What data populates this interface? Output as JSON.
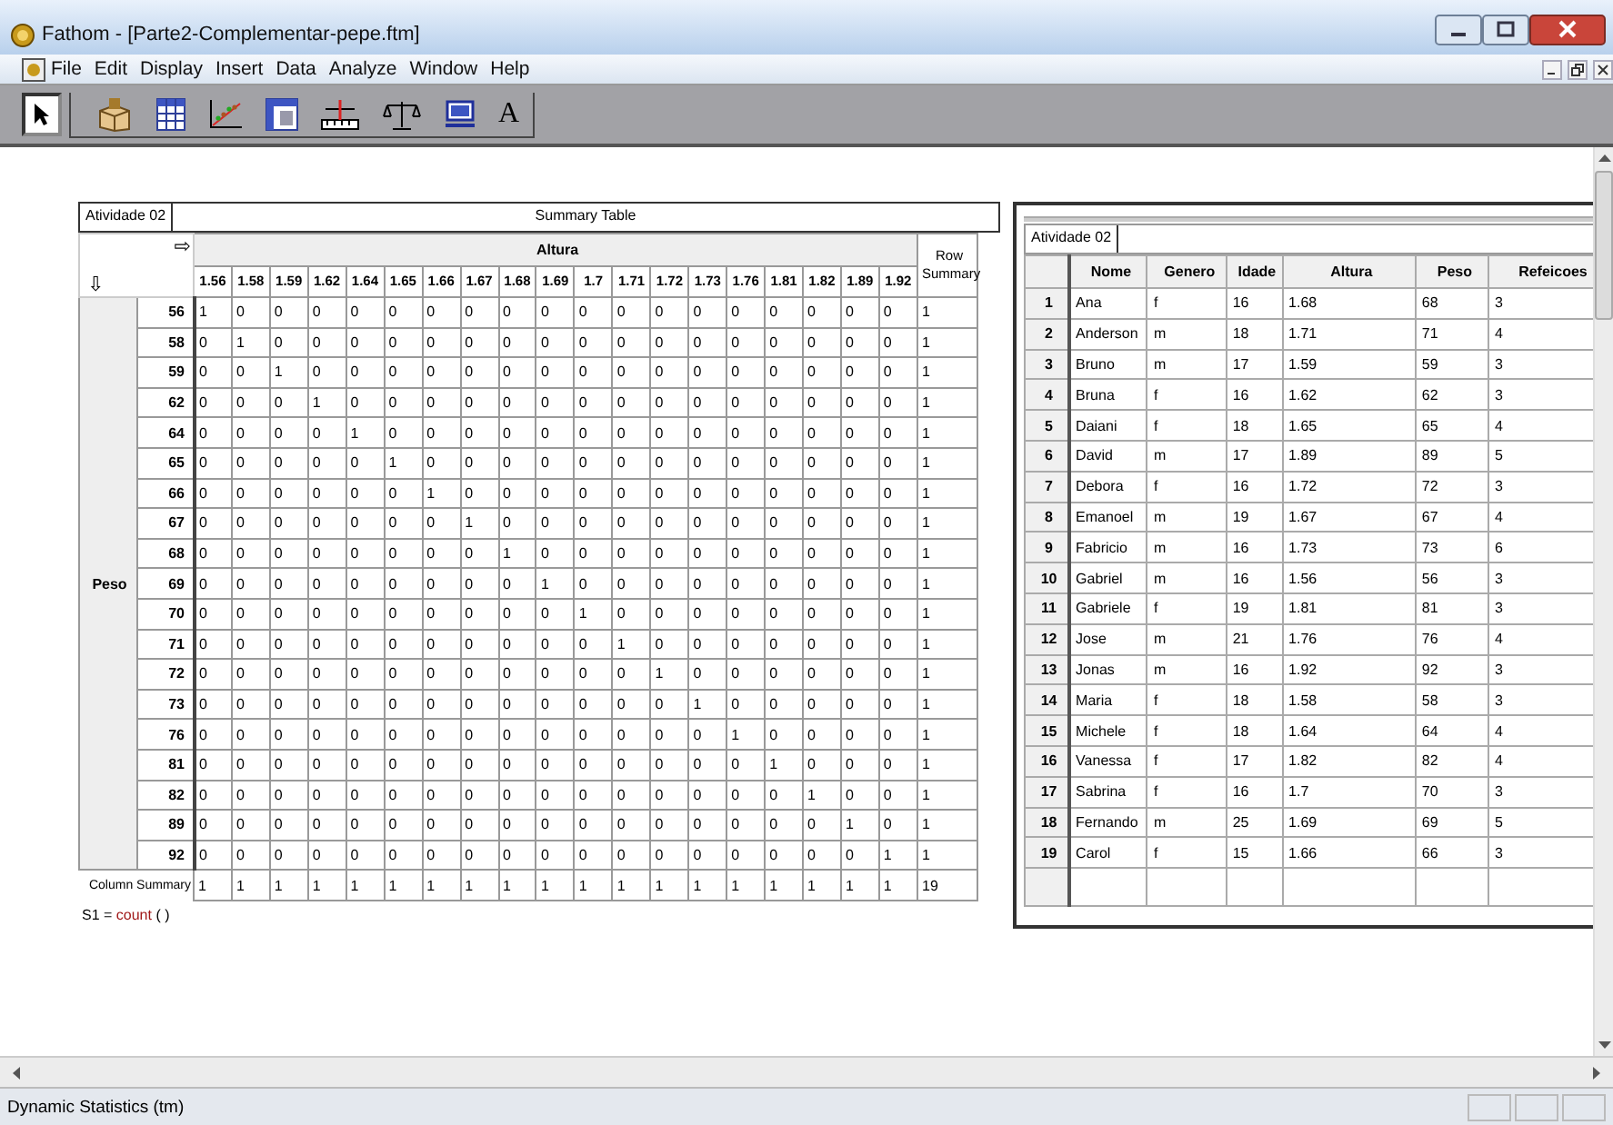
{
  "window": {
    "title": "Fathom - [Parte2-Complementar-pepe.ftm]"
  },
  "menu": [
    "File",
    "Edit",
    "Display",
    "Insert",
    "Data",
    "Analyze",
    "Window",
    "Help"
  ],
  "toolbar": [
    {
      "kind": "pointer",
      "selected": true
    },
    {
      "kind": "box",
      "selected": false
    },
    {
      "kind": "table",
      "selected": false
    },
    {
      "kind": "graph",
      "selected": false
    },
    {
      "kind": "summary",
      "selected": false
    },
    {
      "kind": "ruler",
      "selected": false
    },
    {
      "kind": "scale",
      "selected": false
    },
    {
      "kind": "monitor",
      "selected": false
    },
    {
      "kind": "text",
      "label": "A",
      "selected": false
    }
  ],
  "summary_table": {
    "collection": "Atividade 02",
    "title": "Summary Table",
    "row_arrow": "⇩",
    "column_arrow": "⇨",
    "column_attribute": "Altura",
    "row_attribute": "Peso",
    "row_summary_label": "Row Summary",
    "columns": [
      "1.56",
      "1.58",
      "1.59",
      "1.62",
      "1.64",
      "1.65",
      "1.66",
      "1.67",
      "1.68",
      "1.69",
      "1.7",
      "1.71",
      "1.72",
      "1.73",
      "1.76",
      "1.81",
      "1.82",
      "1.89",
      "1.92"
    ],
    "rows": [
      {
        "label": "56",
        "cells": [
          "1",
          "0",
          "0",
          "0",
          "0",
          "0",
          "0",
          "0",
          "0",
          "0",
          "0",
          "0",
          "0",
          "0",
          "0",
          "0",
          "0",
          "0",
          "0"
        ],
        "summary": "1"
      },
      {
        "label": "58",
        "cells": [
          "0",
          "1",
          "0",
          "0",
          "0",
          "0",
          "0",
          "0",
          "0",
          "0",
          "0",
          "0",
          "0",
          "0",
          "0",
          "0",
          "0",
          "0",
          "0"
        ],
        "summary": "1"
      },
      {
        "label": "59",
        "cells": [
          "0",
          "0",
          "1",
          "0",
          "0",
          "0",
          "0",
          "0",
          "0",
          "0",
          "0",
          "0",
          "0",
          "0",
          "0",
          "0",
          "0",
          "0",
          "0"
        ],
        "summary": "1"
      },
      {
        "label": "62",
        "cells": [
          "0",
          "0",
          "0",
          "1",
          "0",
          "0",
          "0",
          "0",
          "0",
          "0",
          "0",
          "0",
          "0",
          "0",
          "0",
          "0",
          "0",
          "0",
          "0"
        ],
        "summary": "1"
      },
      {
        "label": "64",
        "cells": [
          "0",
          "0",
          "0",
          "0",
          "1",
          "0",
          "0",
          "0",
          "0",
          "0",
          "0",
          "0",
          "0",
          "0",
          "0",
          "0",
          "0",
          "0",
          "0"
        ],
        "summary": "1"
      },
      {
        "label": "65",
        "cells": [
          "0",
          "0",
          "0",
          "0",
          "0",
          "1",
          "0",
          "0",
          "0",
          "0",
          "0",
          "0",
          "0",
          "0",
          "0",
          "0",
          "0",
          "0",
          "0"
        ],
        "summary": "1"
      },
      {
        "label": "66",
        "cells": [
          "0",
          "0",
          "0",
          "0",
          "0",
          "0",
          "1",
          "0",
          "0",
          "0",
          "0",
          "0",
          "0",
          "0",
          "0",
          "0",
          "0",
          "0",
          "0"
        ],
        "summary": "1"
      },
      {
        "label": "67",
        "cells": [
          "0",
          "0",
          "0",
          "0",
          "0",
          "0",
          "0",
          "1",
          "0",
          "0",
          "0",
          "0",
          "0",
          "0",
          "0",
          "0",
          "0",
          "0",
          "0"
        ],
        "summary": "1"
      },
      {
        "label": "68",
        "cells": [
          "0",
          "0",
          "0",
          "0",
          "0",
          "0",
          "0",
          "0",
          "1",
          "0",
          "0",
          "0",
          "0",
          "0",
          "0",
          "0",
          "0",
          "0",
          "0"
        ],
        "summary": "1"
      },
      {
        "label": "69",
        "cells": [
          "0",
          "0",
          "0",
          "0",
          "0",
          "0",
          "0",
          "0",
          "0",
          "1",
          "0",
          "0",
          "0",
          "0",
          "0",
          "0",
          "0",
          "0",
          "0"
        ],
        "summary": "1"
      },
      {
        "label": "70",
        "cells": [
          "0",
          "0",
          "0",
          "0",
          "0",
          "0",
          "0",
          "0",
          "0",
          "0",
          "1",
          "0",
          "0",
          "0",
          "0",
          "0",
          "0",
          "0",
          "0"
        ],
        "summary": "1"
      },
      {
        "label": "71",
        "cells": [
          "0",
          "0",
          "0",
          "0",
          "0",
          "0",
          "0",
          "0",
          "0",
          "0",
          "0",
          "1",
          "0",
          "0",
          "0",
          "0",
          "0",
          "0",
          "0"
        ],
        "summary": "1"
      },
      {
        "label": "72",
        "cells": [
          "0",
          "0",
          "0",
          "0",
          "0",
          "0",
          "0",
          "0",
          "0",
          "0",
          "0",
          "0",
          "1",
          "0",
          "0",
          "0",
          "0",
          "0",
          "0"
        ],
        "summary": "1"
      },
      {
        "label": "73",
        "cells": [
          "0",
          "0",
          "0",
          "0",
          "0",
          "0",
          "0",
          "0",
          "0",
          "0",
          "0",
          "0",
          "0",
          "1",
          "0",
          "0",
          "0",
          "0",
          "0"
        ],
        "summary": "1"
      },
      {
        "label": "76",
        "cells": [
          "0",
          "0",
          "0",
          "0",
          "0",
          "0",
          "0",
          "0",
          "0",
          "0",
          "0",
          "0",
          "0",
          "0",
          "1",
          "0",
          "0",
          "0",
          "0"
        ],
        "summary": "1"
      },
      {
        "label": "81",
        "cells": [
          "0",
          "0",
          "0",
          "0",
          "0",
          "0",
          "0",
          "0",
          "0",
          "0",
          "0",
          "0",
          "0",
          "0",
          "0",
          "1",
          "0",
          "0",
          "0"
        ],
        "summary": "1"
      },
      {
        "label": "82",
        "cells": [
          "0",
          "0",
          "0",
          "0",
          "0",
          "0",
          "0",
          "0",
          "0",
          "0",
          "0",
          "0",
          "0",
          "0",
          "0",
          "0",
          "1",
          "0",
          "0"
        ],
        "summary": "1"
      },
      {
        "label": "89",
        "cells": [
          "0",
          "0",
          "0",
          "0",
          "0",
          "0",
          "0",
          "0",
          "0",
          "0",
          "0",
          "0",
          "0",
          "0",
          "0",
          "0",
          "0",
          "1",
          "0"
        ],
        "summary": "1"
      },
      {
        "label": "92",
        "cells": [
          "0",
          "0",
          "0",
          "0",
          "0",
          "0",
          "0",
          "0",
          "0",
          "0",
          "0",
          "0",
          "0",
          "0",
          "0",
          "0",
          "0",
          "0",
          "1"
        ],
        "summary": "1"
      }
    ],
    "column_summary_label": "Column Summary",
    "column_summary": [
      "1",
      "1",
      "1",
      "1",
      "1",
      "1",
      "1",
      "1",
      "1",
      "1",
      "1",
      "1",
      "1",
      "1",
      "1",
      "1",
      "1",
      "1",
      "1"
    ],
    "total": "19",
    "formula": {
      "lhs": "S1 =",
      "function": "count",
      "args": "( )"
    }
  },
  "case_table": {
    "collection": "Atividade 02",
    "columns": [
      "Nome",
      "Genero",
      "Idade",
      "Altura",
      "Peso",
      "Refeicoes"
    ],
    "rows": [
      {
        "index": "1",
        "cells": [
          "Ana",
          "f",
          "16",
          "1.68",
          "68",
          "3"
        ]
      },
      {
        "index": "2",
        "cells": [
          "Anderson",
          "m",
          "18",
          "1.71",
          "71",
          "4"
        ]
      },
      {
        "index": "3",
        "cells": [
          "Bruno",
          "m",
          "17",
          "1.59",
          "59",
          "3"
        ]
      },
      {
        "index": "4",
        "cells": [
          "Bruna",
          "f",
          "16",
          "1.62",
          "62",
          "3"
        ]
      },
      {
        "index": "5",
        "cells": [
          "Daiani",
          "f",
          "18",
          "1.65",
          "65",
          "4"
        ]
      },
      {
        "index": "6",
        "cells": [
          "David",
          "m",
          "17",
          "1.89",
          "89",
          "5"
        ]
      },
      {
        "index": "7",
        "cells": [
          "Debora",
          "f",
          "16",
          "1.72",
          "72",
          "3"
        ]
      },
      {
        "index": "8",
        "cells": [
          "Emanoel",
          "m",
          "19",
          "1.67",
          "67",
          "4"
        ]
      },
      {
        "index": "9",
        "cells": [
          "Fabricio",
          "m",
          "16",
          "1.73",
          "73",
          "6"
        ]
      },
      {
        "index": "10",
        "cells": [
          "Gabriel",
          "m",
          "16",
          "1.56",
          "56",
          "3"
        ]
      },
      {
        "index": "11",
        "cells": [
          "Gabriele",
          "f",
          "19",
          "1.81",
          "81",
          "3"
        ]
      },
      {
        "index": "12",
        "cells": [
          "Jose",
          "m",
          "21",
          "1.76",
          "76",
          "4"
        ]
      },
      {
        "index": "13",
        "cells": [
          "Jonas",
          "m",
          "16",
          "1.92",
          "92",
          "3"
        ]
      },
      {
        "index": "14",
        "cells": [
          "Maria",
          "f",
          "18",
          "1.58",
          "58",
          "3"
        ]
      },
      {
        "index": "15",
        "cells": [
          "Michele",
          "f",
          "18",
          "1.64",
          "64",
          "4"
        ]
      },
      {
        "index": "16",
        "cells": [
          "Vanessa",
          "f",
          "17",
          "1.82",
          "82",
          "4"
        ]
      },
      {
        "index": "17",
        "cells": [
          "Sabrina",
          "f",
          "16",
          "1.7",
          "70",
          "3"
        ]
      },
      {
        "index": "18",
        "cells": [
          "Fernando",
          "m",
          "25",
          "1.69",
          "69",
          "5"
        ]
      },
      {
        "index": "19",
        "cells": [
          "Carol",
          "f",
          "15",
          "1.66",
          "66",
          "3"
        ]
      }
    ]
  },
  "status_bar": {
    "text": "Dynamic Statistics (tm)"
  }
}
